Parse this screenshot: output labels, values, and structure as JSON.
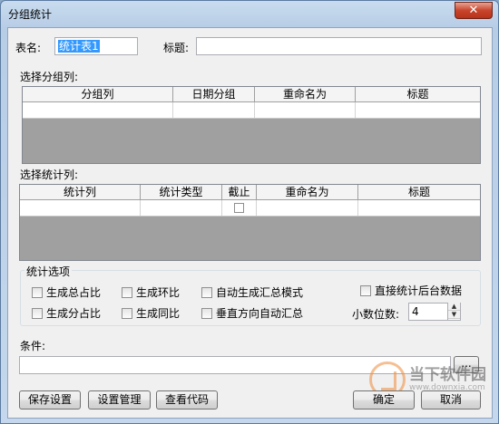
{
  "window": {
    "title": "分组统计",
    "close_glyph": "✕"
  },
  "form": {
    "table_name_label": "表名:",
    "table_name_value": "统计表1",
    "title_label": "标题:",
    "title_value": ""
  },
  "group_section": {
    "label": "选择分组列:",
    "columns": [
      "分组列",
      "日期分组",
      "重命名为",
      "标题"
    ]
  },
  "stat_section": {
    "label": "选择统计列:",
    "columns": [
      "统计列",
      "统计类型",
      "截止",
      "重命名为",
      "标题"
    ]
  },
  "options": {
    "label": "统计选项",
    "total_ratio": "生成总占比",
    "ring_ratio": "生成环比",
    "auto_summary_mode": "自动生成汇总模式",
    "direct_backend": "直接统计后台数据",
    "group_ratio": "生成分占比",
    "yoy_ratio": "生成同比",
    "vertical_auto_summary": "垂直方向自动汇总",
    "decimal_label": "小数位数:",
    "decimal_value": "4"
  },
  "condition": {
    "label": "条件:",
    "value": "",
    "browse_label": "..."
  },
  "buttons": {
    "save_settings": "保存设置",
    "manage_settings": "设置管理",
    "view_code": "查看代码",
    "ok": "确定",
    "cancel": "取消"
  },
  "watermark": {
    "brand": "当下软件园",
    "url": "www.downxia.com"
  }
}
